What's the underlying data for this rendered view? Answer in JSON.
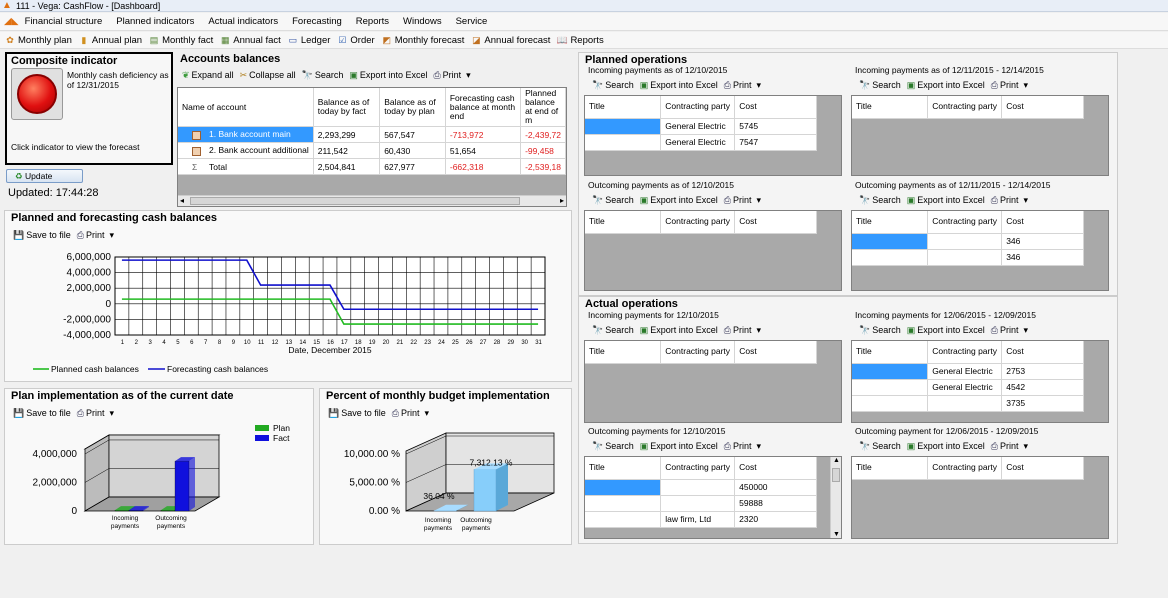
{
  "window": {
    "title": "111 - Vega: CashFlow - [Dashboard]"
  },
  "menu": [
    "Financial structure",
    "Planned indicators",
    "Actual indicators",
    "Forecasting",
    "Reports",
    "Windows",
    "Service"
  ],
  "toolbar": [
    "Monthly plan",
    "Annual plan",
    "Monthly fact",
    "Annual fact",
    "Ledger",
    "Order",
    "Monthly forecast",
    "Annual forecast",
    "Reports"
  ],
  "common": {
    "search": "Search",
    "export": "Export into Excel",
    "print": "Print",
    "save": "Save to file",
    "expand": "Expand all",
    "collapse": "Collapse all"
  },
  "composite": {
    "title": "Composite indicator",
    "text": "Monthly cash deficiency as of 12/31/2015",
    "hint": "Click indicator to view the forecast",
    "update": "Update",
    "updated": "Updated: 17:44:28"
  },
  "accounts": {
    "title": "Accounts balances",
    "headers": [
      "Name of account",
      "Balance as of today by fact",
      "Balance as of today by plan",
      "Forecasting cash balance at month end",
      "Planned balance at end of m"
    ],
    "rows": [
      {
        "name": "1. Bank account main",
        "fact": "2,293,299",
        "plan": "567,547",
        "forecast": "-713,972",
        "planned": "-2,439,72"
      },
      {
        "name": "2. Bank account additional",
        "fact": "211,542",
        "plan": "60,430",
        "forecast": "51,654",
        "planned": "-99,458"
      },
      {
        "name": "Total",
        "fact": "2,504,841",
        "plan": "627,977",
        "forecast": "-662,318",
        "planned": "-2,539,18"
      }
    ]
  },
  "balances_chart": {
    "title": "Planned and forecasting cash balances",
    "xlabel": "Date, December 2015",
    "legend": [
      "Planned cash balances",
      "Forecasting cash balances"
    ],
    "yticks": [
      "6,000,000",
      "4,000,000",
      "2,000,000",
      "0",
      "-2,000,000",
      "-4,000,000"
    ]
  },
  "plan_impl": {
    "title": "Plan implementation as of the current date",
    "legend": [
      "Plan",
      "Fact"
    ],
    "yticks": [
      "4,000,000",
      "2,000,000",
      "0"
    ],
    "categories": [
      "Incoming payments",
      "Outcoming payments"
    ]
  },
  "percent_impl": {
    "title": "Percent of monthly budget implementation",
    "yticks": [
      "10,000.00 %",
      "5,000.00 %",
      "0.00 %"
    ],
    "labels": [
      "36.04 %",
      "7,312.13 %"
    ],
    "categories": [
      "Incoming payments",
      "Outcoming payments"
    ]
  },
  "planned_ops": {
    "title": "Planned operations",
    "in1": {
      "title": "Incoming payments as of 12/10/2015",
      "rows": [
        [
          "",
          "General Electric",
          "5745"
        ],
        [
          "",
          "General Electric",
          "7547"
        ]
      ]
    },
    "in2": {
      "title": "Incoming payments as of 12/11/2015 - 12/14/2015",
      "rows": []
    },
    "out1": {
      "title": "Outcoming payments as of 12/10/2015",
      "rows": []
    },
    "out2": {
      "title": "Outcoming payments as of 12/11/2015 - 12/14/2015",
      "rows": [
        [
          "",
          "",
          "346"
        ],
        [
          "",
          "",
          "346"
        ]
      ]
    }
  },
  "actual_ops": {
    "title": "Actual operations",
    "in1": {
      "title": "Incoming payments for 12/10/2015",
      "rows": []
    },
    "in2": {
      "title": "Incoming payments for 12/06/2015 - 12/09/2015",
      "rows": [
        [
          "",
          "General Electric",
          "2753"
        ],
        [
          "",
          "General Electric",
          "4542"
        ],
        [
          "",
          "",
          "3735"
        ]
      ]
    },
    "out1": {
      "title": "Outcoming payments for 12/10/2015",
      "rows": [
        [
          "",
          "",
          "450000"
        ],
        [
          "",
          "",
          "59888"
        ],
        [
          "",
          "law firm, Ltd",
          "2320"
        ]
      ]
    },
    "out2": {
      "title": "Outcoming payment for 12/06/2015 - 12/09/2015",
      "rows": []
    }
  },
  "ops_headers": [
    "Title",
    "Contracting party",
    "Cost"
  ],
  "chart_data": [
    {
      "type": "line",
      "title": "Planned and forecasting cash balances",
      "xlabel": "Date, December 2015",
      "ylabel": "",
      "x": [
        1,
        2,
        3,
        4,
        5,
        6,
        7,
        8,
        9,
        10,
        11,
        12,
        13,
        14,
        15,
        16,
        17,
        18,
        19,
        20,
        21,
        22,
        23,
        24,
        25,
        26,
        27,
        28,
        29,
        30,
        31
      ],
      "ylim": [
        -4000000,
        6000000
      ],
      "series": [
        {
          "name": "Planned cash balances",
          "color": "#22bb22",
          "values": [
            600000,
            600000,
            600000,
            600000,
            600000,
            600000,
            600000,
            600000,
            600000,
            600000,
            600000,
            600000,
            600000,
            600000,
            600000,
            600000,
            -2600000,
            -2600000,
            -2600000,
            -2600000,
            -2600000,
            -2600000,
            -2600000,
            -2600000,
            -2600000,
            -2600000,
            -2600000,
            -2600000,
            -2600000,
            -2600000,
            -2600000
          ]
        },
        {
          "name": "Forecasting cash balances",
          "color": "#1010cc",
          "values": [
            5600000,
            5600000,
            5600000,
            5600000,
            5600000,
            5600000,
            5600000,
            5600000,
            5600000,
            5600000,
            2400000,
            2400000,
            2400000,
            2400000,
            2400000,
            2400000,
            -700000,
            -700000,
            -700000,
            -700000,
            -700000,
            -700000,
            -700000,
            -700000,
            -700000,
            -700000,
            -700000,
            -700000,
            -700000,
            -700000,
            -700000
          ]
        }
      ]
    },
    {
      "type": "bar",
      "title": "Plan implementation as of the current date",
      "categories": [
        "Incoming payments",
        "Outcoming payments"
      ],
      "ylim": [
        0,
        4000000
      ],
      "series": [
        {
          "name": "Plan",
          "color": "#22aa22",
          "values": [
            60000,
            60000
          ]
        },
        {
          "name": "Fact",
          "color": "#1010dd",
          "values": [
            60000,
            3500000
          ]
        }
      ]
    },
    {
      "type": "bar",
      "title": "Percent of monthly budget implementation",
      "categories": [
        "Incoming payments",
        "Outcoming payments"
      ],
      "ylim": [
        0,
        10000
      ],
      "values": [
        36.04,
        7312.13
      ]
    }
  ]
}
